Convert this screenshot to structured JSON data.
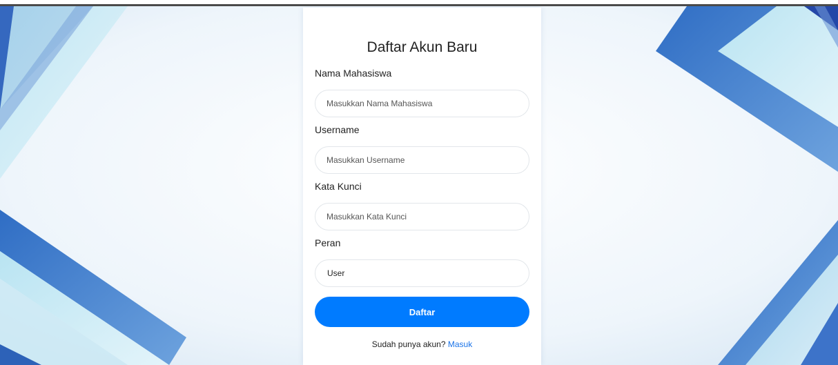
{
  "form": {
    "title": "Daftar Akun Baru",
    "fields": [
      {
        "label": "Nama Mahasiswa",
        "placeholder": "Masukkan Nama Mahasiswa",
        "value": ""
      },
      {
        "label": "Username",
        "placeholder": "Masukkan Username",
        "value": ""
      },
      {
        "label": "Kata Kunci",
        "placeholder": "Masukkan Kata Kunci",
        "value": ""
      }
    ],
    "role": {
      "label": "Peran",
      "selected": "User"
    },
    "submit_label": "Daftar",
    "login_prompt": "Sudah punya akun?",
    "login_link": "Masuk"
  },
  "colors": {
    "accent": "#007bff",
    "link": "#1a73e8",
    "background": "#eaf3fa"
  }
}
